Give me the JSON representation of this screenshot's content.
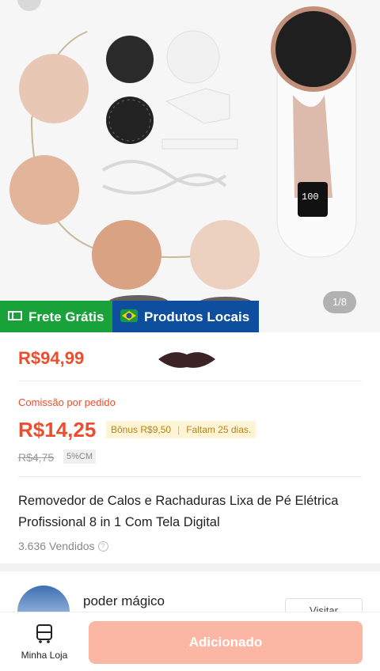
{
  "product_gallery": {
    "page_indicator": "1/8",
    "badges": [
      {
        "label": "Frete Grátis",
        "icon": "truck-icon",
        "color": "#1aa23a"
      },
      {
        "label": "Produtos Locais",
        "icon": "brazil-flag-icon",
        "color": "#0e4e9e"
      }
    ]
  },
  "price": {
    "current": "R$94,99",
    "accent_color": "#ee4d2d"
  },
  "commission": {
    "label": "Comissão por pedido",
    "amount": "R$14,25",
    "bonus": "Bônus R$9,50",
    "remaining": "Faltam 25 dias.",
    "old_amount": "R$4,75",
    "rate_tag": "5%CM"
  },
  "product": {
    "title": "Removedor de Calos e Rachaduras Lixa de Pé Elétrica Profissional 8 in 1 Com Tela Digital",
    "sold": "3.636 Vendidos"
  },
  "shop": {
    "name": "poder mágico",
    "visit_label": "Visitar"
  },
  "bottom_bar": {
    "my_store_label": "Minha Loja",
    "add_button_label": "Adicionado"
  }
}
